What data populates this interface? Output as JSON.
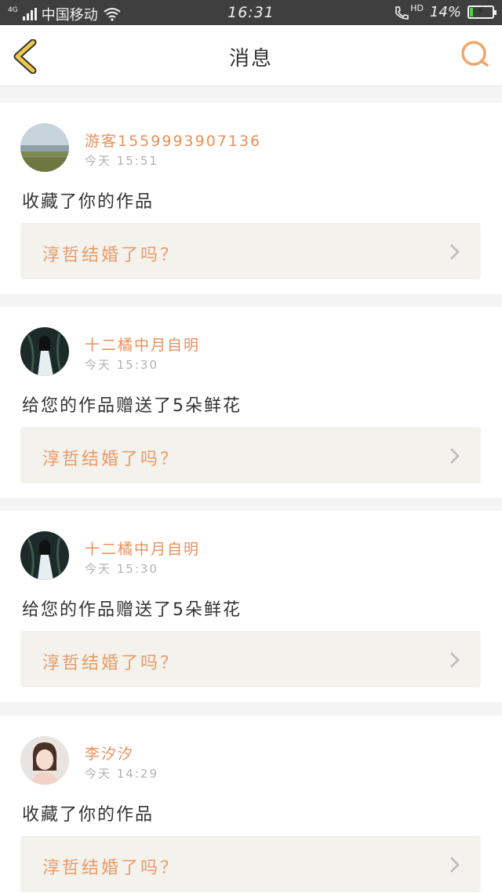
{
  "status_bar": {
    "network": "4G",
    "carrier": "中国移动",
    "time": "16:31",
    "hd": "HD",
    "battery": "14%",
    "battery_level": 0.14
  },
  "header": {
    "title": "消息"
  },
  "messages": [
    {
      "username": "游客15599939071​36",
      "time": "今天 15:51",
      "action": "收藏了你的作品",
      "work_title": "淳哲结婚了吗？"
    },
    {
      "username": "十二橘中月自明",
      "time": "今天 15:30",
      "action": "给您的作品赠送了5朵鲜花",
      "work_title": "淳哲结婚了吗？"
    },
    {
      "username": "十二橘中月自明",
      "time": "今天 15:30",
      "action": "给您的作品赠送了5朵鲜花",
      "work_title": "淳哲结婚了吗？"
    },
    {
      "username": "李汐汐",
      "time": "今天 14:29",
      "action": "收藏了你的作品",
      "work_title": "淳哲结婚了吗？"
    }
  ],
  "colors": {
    "accent": "#e8905a",
    "back_arrow": "#f0c94a",
    "card_link_bg": "#f3f2ed"
  }
}
